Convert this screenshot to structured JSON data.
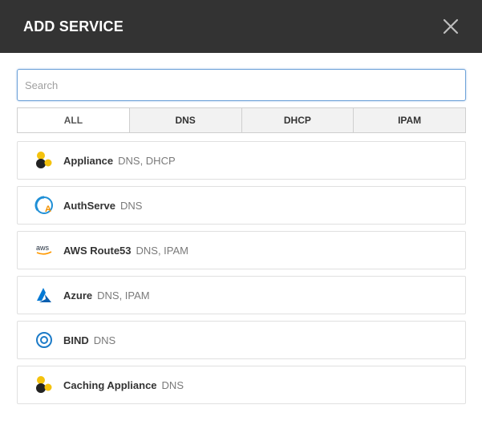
{
  "modal": {
    "title": "ADD SERVICE",
    "close_icon": "close-icon"
  },
  "search": {
    "placeholder": "Search",
    "value": ""
  },
  "tabs": [
    {
      "label": "ALL",
      "active": true
    },
    {
      "label": "DNS",
      "active": false
    },
    {
      "label": "DHCP",
      "active": false
    },
    {
      "label": "IPAM",
      "active": false
    }
  ],
  "services": [
    {
      "name": "Appliance",
      "tags": "DNS, DHCP",
      "icon": "appliance-icon"
    },
    {
      "name": "AuthServe",
      "tags": "DNS",
      "icon": "authserve-icon"
    },
    {
      "name": "AWS Route53",
      "tags": "DNS, IPAM",
      "icon": "aws-icon"
    },
    {
      "name": "Azure",
      "tags": "DNS, IPAM",
      "icon": "azure-icon"
    },
    {
      "name": "BIND",
      "tags": "DNS",
      "icon": "bind-icon"
    },
    {
      "name": "Caching Appliance",
      "tags": "DNS",
      "icon": "caching-appliance-icon"
    }
  ],
  "colors": {
    "header_bg": "#333333",
    "accent": "#6fa3d9",
    "appliance_yellow": "#f4c20d",
    "azure_blue": "#0078d4",
    "authserve_blue": "#1f8fd6",
    "aws_orange": "#ff9900"
  }
}
